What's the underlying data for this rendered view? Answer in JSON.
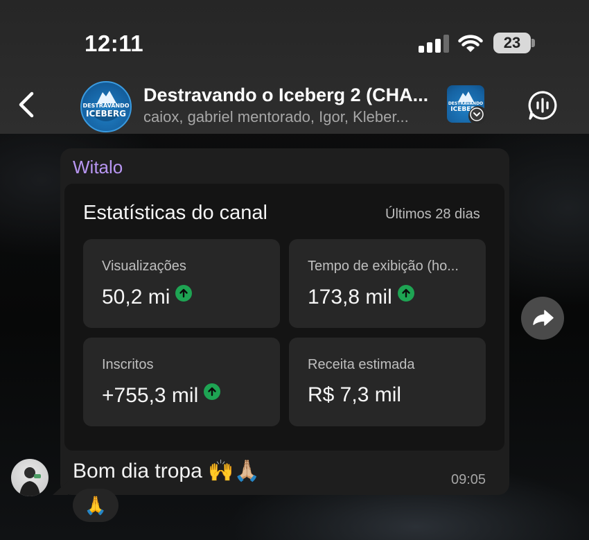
{
  "status_bar": {
    "time": "12:11",
    "battery": "23"
  },
  "header": {
    "title": "Destravando o Iceberg 2 (CHA...",
    "subtitle": "caiox, gabriel mentorado, Igor, Kleber...",
    "avatar_text_line1": "DESTRAVANDO",
    "avatar_text_line2": "ICEBERG",
    "icons": {
      "back": "chevron-left-icon",
      "voice": "voice-chat-icon",
      "thumb_badge": "chevron-down-icon"
    }
  },
  "message": {
    "sender": "Witalo",
    "sender_color": "#b896f2",
    "card": {
      "title": "Estatísticas do canal",
      "period": "Últimos 28 dias",
      "stats": [
        {
          "label": "Visualizações",
          "value": "50,2 mi",
          "trend": "up"
        },
        {
          "label": "Tempo de exibição (ho...",
          "value": "173,8 mil",
          "trend": "up"
        },
        {
          "label": "Inscritos",
          "value": "+755,3 mil",
          "trend": "up"
        },
        {
          "label": "Receita estimada",
          "value": "R$ 7,3 mil",
          "trend": "none"
        }
      ],
      "trend_color": "#1ea453"
    },
    "text": "Bom dia tropa 🙌🙏🏼",
    "time": "09:05",
    "reaction": "🙏"
  },
  "actions": {
    "forward_icon": "forward-arrow-icon"
  }
}
